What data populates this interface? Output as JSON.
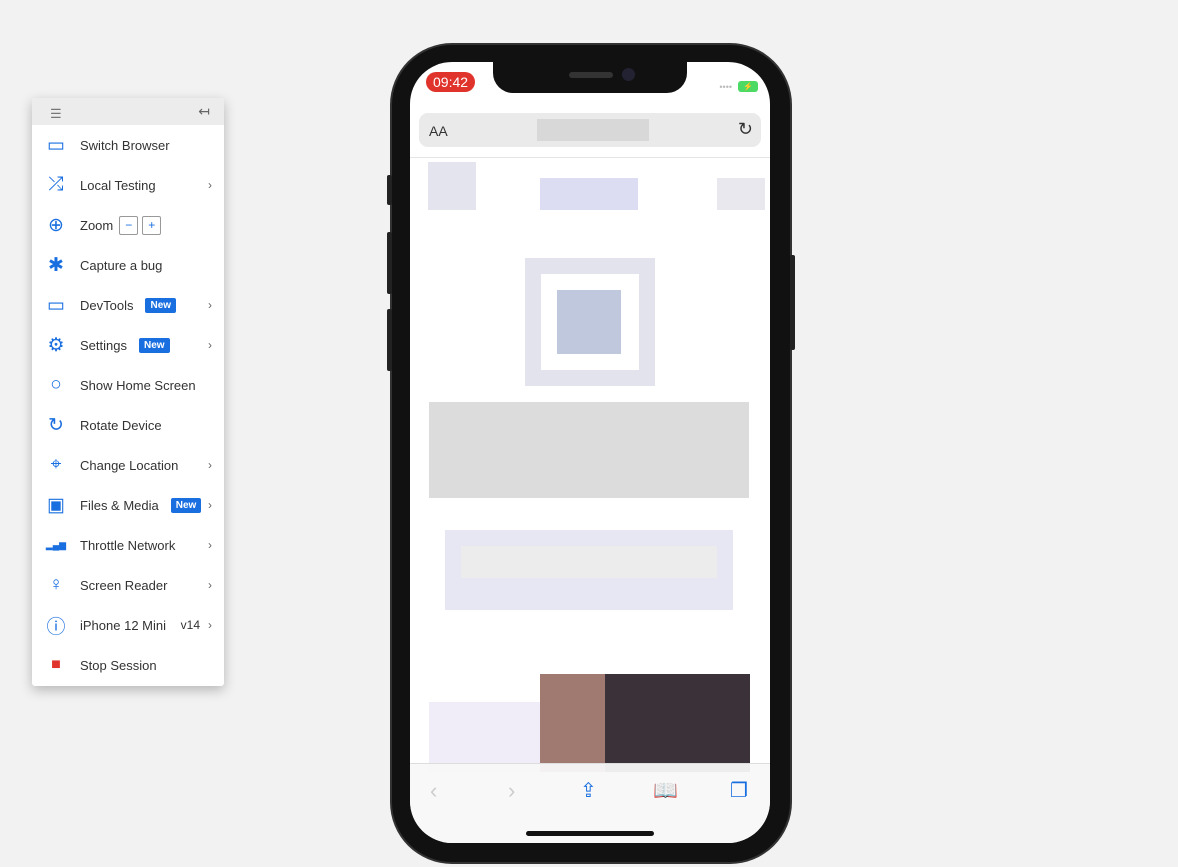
{
  "toolbar": {
    "menu_icon": "hamburger-icon",
    "collapse_icon": "collapse-left-icon"
  },
  "menu": [
    {
      "label": "Switch Browser",
      "icon": "devices-icon"
    },
    {
      "label": "Local Testing",
      "icon": "shuffle-icon",
      "chevron": true
    },
    {
      "label": "Zoom",
      "icon": "zoom-in-icon",
      "zoom_out": "−",
      "zoom_in": "+"
    },
    {
      "label": "Capture a bug",
      "icon": "bug-icon"
    },
    {
      "label": "DevTools",
      "icon": "window-icon",
      "badge": "New",
      "chevron": true
    },
    {
      "label": "Settings",
      "icon": "gear-icon",
      "badge": "New",
      "chevron": true
    },
    {
      "label": "Show Home Screen",
      "icon": "circle-icon"
    },
    {
      "label": "Rotate Device",
      "icon": "rotate-icon"
    },
    {
      "label": "Change Location",
      "icon": "location-pin-icon",
      "chevron": true
    },
    {
      "label": "Files & Media",
      "icon": "image-icon",
      "badge": "New",
      "chevron": true
    },
    {
      "label": "Throttle Network",
      "icon": "signal-bars-icon",
      "chevron": true
    },
    {
      "label": "Screen Reader",
      "icon": "accessibility-icon",
      "chevron": true
    },
    {
      "label": "iPhone 12 Mini",
      "icon": "info-icon",
      "version": "v14",
      "chevron": true
    },
    {
      "label": "Stop Session",
      "icon": "stop-icon"
    }
  ],
  "device": {
    "time": "09:42",
    "text_size": "AA",
    "accent": "#1a6fe0",
    "stop_color": "#e0332b"
  }
}
